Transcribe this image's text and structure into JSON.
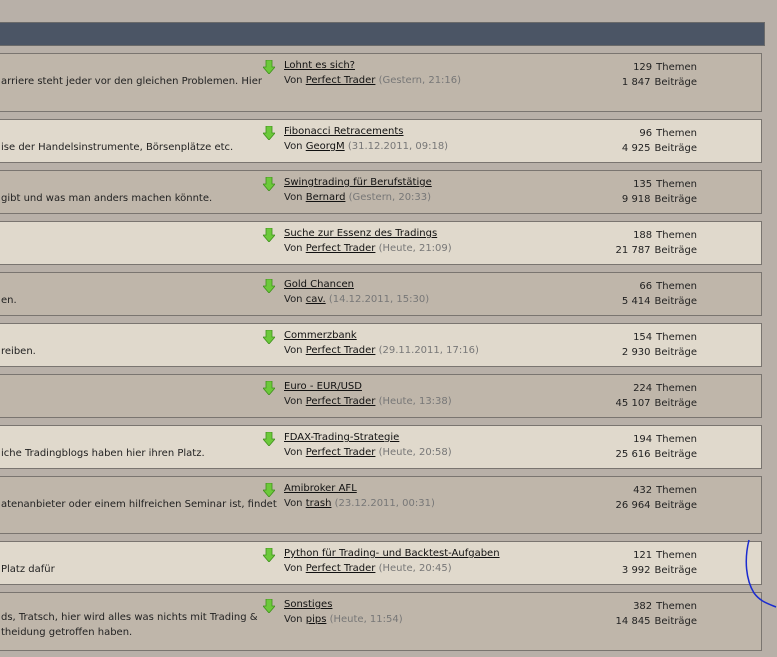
{
  "forums": [
    {
      "desc": [
        "arriere steht jeder vor den gleichen Problemen. Hier"
      ],
      "last_title": "Lohnt es sich?",
      "by_label": "Von",
      "author": "Perfect Trader",
      "date": "(Gestern, 21:16)",
      "topics": "129",
      "topics_label": "Themen",
      "posts": "1 847",
      "posts_label": "Beiträge"
    },
    {
      "desc": [
        "ise der Handelsinstrumente, Börsenplätze etc."
      ],
      "last_title": "Fibonacci Retracements",
      "by_label": "Von",
      "author": "GeorgM",
      "date": "(31.12.2011, 09:18)",
      "topics": "96",
      "topics_label": "Themen",
      "posts": "4 925",
      "posts_label": "Beiträge"
    },
    {
      "desc": [
        "gibt und was man anders machen könnte."
      ],
      "last_title": "Swingtrading für Berufstätige",
      "by_label": "Von",
      "author": "Bernard",
      "date": "(Gestern, 20:33)",
      "topics": "135",
      "topics_label": "Themen",
      "posts": "9 918",
      "posts_label": "Beiträge"
    },
    {
      "desc": [
        ""
      ],
      "last_title": "Suche zur Essenz des Tradings",
      "by_label": "Von",
      "author": "Perfect Trader",
      "date": "(Heute, 21:09)",
      "topics": "188",
      "topics_label": "Themen",
      "posts": "21 787",
      "posts_label": "Beiträge"
    },
    {
      "desc": [
        "en."
      ],
      "last_title": "Gold Chancen",
      "by_label": "Von",
      "author": "cav.",
      "date": "(14.12.2011, 15:30)",
      "topics": "66",
      "topics_label": "Themen",
      "posts": "5 414",
      "posts_label": "Beiträge"
    },
    {
      "desc": [
        "reiben."
      ],
      "last_title": "Commerzbank",
      "by_label": "Von",
      "author": "Perfect Trader",
      "date": "(29.11.2011, 17:16)",
      "topics": "154",
      "topics_label": "Themen",
      "posts": "2 930",
      "posts_label": "Beiträge"
    },
    {
      "desc": [
        ""
      ],
      "last_title": "Euro - EUR/USD",
      "by_label": "Von",
      "author": "Perfect Trader",
      "date": "(Heute, 13:38)",
      "topics": "224",
      "topics_label": "Themen",
      "posts": "45 107",
      "posts_label": "Beiträge"
    },
    {
      "desc": [
        "iche Tradingblogs haben hier ihren Platz."
      ],
      "last_title": "FDAX-Trading-Strategie",
      "by_label": "Von",
      "author": "Perfect Trader",
      "date": "(Heute, 20:58)",
      "topics": "194",
      "topics_label": "Themen",
      "posts": "25 616",
      "posts_label": "Beiträge"
    },
    {
      "desc": [
        "atenanbieter oder einem hilfreichen Seminar ist, findet"
      ],
      "last_title": "Amibroker AFL",
      "by_label": "Von",
      "author": "trash",
      "date": "(23.12.2011, 00:31)",
      "topics": "432",
      "topics_label": "Themen",
      "posts": "26 964",
      "posts_label": "Beiträge"
    },
    {
      "desc": [
        "Platz dafür"
      ],
      "last_title": "Python für Trading- und Backtest-Aufgaben",
      "by_label": "Von",
      "author": "Perfect Trader",
      "date": "(Heute, 20:45)",
      "topics": "121",
      "topics_label": "Themen",
      "posts": "3 992",
      "posts_label": "Beiträge"
    },
    {
      "desc": [
        "ds, Tratsch, hier wird alles was nichts mit Trading &",
        "theidung getroffen haben."
      ],
      "last_title": "Sonstiges",
      "by_label": "Von",
      "author": "pips",
      "date": "(Heute, 11:54)",
      "topics": "382",
      "topics_label": "Themen",
      "posts": "14 845",
      "posts_label": "Beiträge"
    }
  ]
}
